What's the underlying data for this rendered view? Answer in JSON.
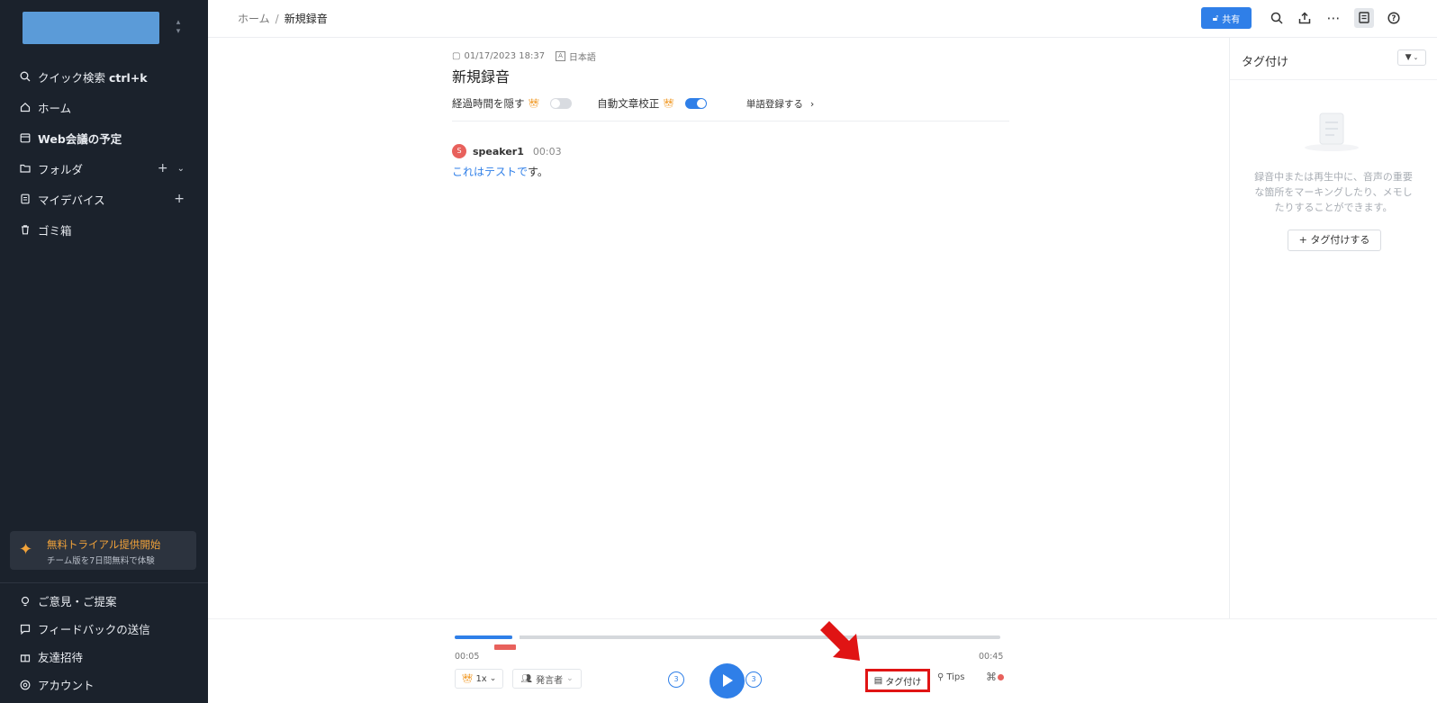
{
  "sidebar": {
    "nav": [
      {
        "label": "クイック検索 ",
        "shortcut": "ctrl+k",
        "icon": "search-icon"
      },
      {
        "label": "ホーム",
        "icon": "home-icon"
      },
      {
        "label": "Web会議の予定",
        "icon": "calendar-icon"
      },
      {
        "label": "フォルダ",
        "icon": "folder-icon"
      },
      {
        "label": "マイデバイス",
        "icon": "device-icon"
      },
      {
        "label": "ゴミ箱",
        "icon": "trash-icon"
      }
    ],
    "trial": {
      "title": "無料トライアル提供開始",
      "subtitle": "チーム版を7日間無料で体験"
    },
    "bottom": [
      {
        "label": "ご意見・ご提案",
        "icon": "lightbulb-icon"
      },
      {
        "label": "フィードバックの送信",
        "icon": "feedback-icon"
      },
      {
        "label": "友達招待",
        "icon": "gift-icon"
      },
      {
        "label": "アカウント",
        "icon": "account-icon"
      }
    ]
  },
  "topbar": {
    "breadcrumb": {
      "root": "ホーム",
      "separator": "/",
      "current": "新規録音"
    },
    "share_label": "共有"
  },
  "document": {
    "date": "01/17/2023 18:37",
    "language": "日本語",
    "title": "新規録音",
    "hide_elapsed_label": "経過時間を隠す",
    "hide_elapsed_on": false,
    "auto_correct_label": "自動文章校正",
    "auto_correct_on": true,
    "dictionary_label": "単語登録する",
    "speaker_initial": "S",
    "speaker_name": "speaker1",
    "speaker_time": "00:03",
    "transcript_highlight": "これはテストで",
    "transcript_rest": "す。"
  },
  "tag_panel": {
    "title": "タグ付け",
    "empty_text": "録音中または再生中に、音声の重要な箇所をマーキングしたり、メモしたりすることができます。",
    "add_button": "+ タグ付けする"
  },
  "player": {
    "time_start": "00:05",
    "time_end": "00:45",
    "progress": 0.106,
    "speed": "1x",
    "speaker_select": "発言者",
    "skip_back": "3",
    "skip_forward": "3",
    "tag_label": "タグ付け",
    "tips_label": "Tips"
  },
  "colors": {
    "accent": "#2f7fe8",
    "sidebar_bg": "#1b222c",
    "trial_orange": "#f2a33a",
    "highlight_red": "#e01414"
  }
}
